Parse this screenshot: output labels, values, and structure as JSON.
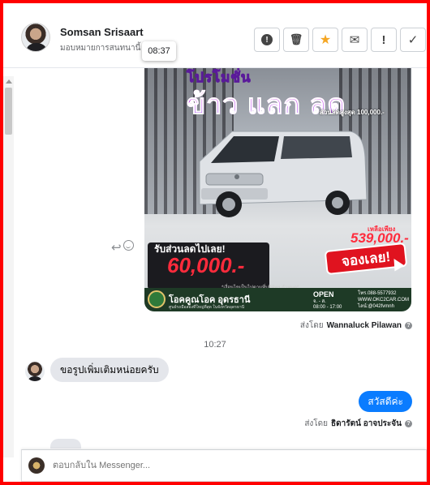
{
  "header": {
    "contact_name": "Somsan Srisaart",
    "assign_label": "มอบหมายการสนทนานี้",
    "tooltip_time": "08:37"
  },
  "toolbar": {
    "icons": [
      "exclamation-circle-icon",
      "trash-icon",
      "star-icon",
      "envelope-icon",
      "exclamation-icon",
      "check-icon"
    ],
    "excl_circle_glyph": "!",
    "trash_glyph": "🗑",
    "star_glyph": "★",
    "envelope_glyph": "✉",
    "exclamation_glyph": "!",
    "check_glyph": "✓",
    "star_color": "#f5a623"
  },
  "ad_image": {
    "promo_top": "โปรโมชั่น",
    "headline": "ข้าว แลก ลด",
    "discount_small": "ส่วนลดสูงสุด 100,000.-",
    "discount_label": "รับส่วนลดไปเลย!",
    "discount_amount": "60,000.-",
    "remain_label": "เหลือเพียง",
    "remain_price": "539,000.-",
    "cta": "จองเลย!",
    "note": "*เงื่อนไขเป็นไปตามที่บริษัทฯ กำหนด*",
    "brand": "โอคคูณโอค อุดรธานี",
    "brand_sub": "ศูนย์รถมือสองที่ใหญ่ที่สุด ในจังหวัดอุดรธานี",
    "open_label": "OPEN",
    "open_days": "จ. - ส.",
    "open_hours": "08:00 - 17:00",
    "phone": "โทร.088-5577932",
    "website": "WWW.OKC2CAR.COM",
    "line": "ไลน์:@042fvmnh"
  },
  "messages": {
    "sent_by_prefix": "ส่งโดย",
    "first_sender": "Wannaluck Pilawan",
    "time_divider": "10:27",
    "incoming_text": "ขอรูปเพิ่มเติมหน่อยครับ",
    "outgoing_text": "สวัสดีค่ะ",
    "second_sender": "ธิดารัตน์ อาจประจัน",
    "outgoing_color": "#0a7cff"
  },
  "composer": {
    "placeholder": "ตอบกลับใน Messenger..."
  }
}
